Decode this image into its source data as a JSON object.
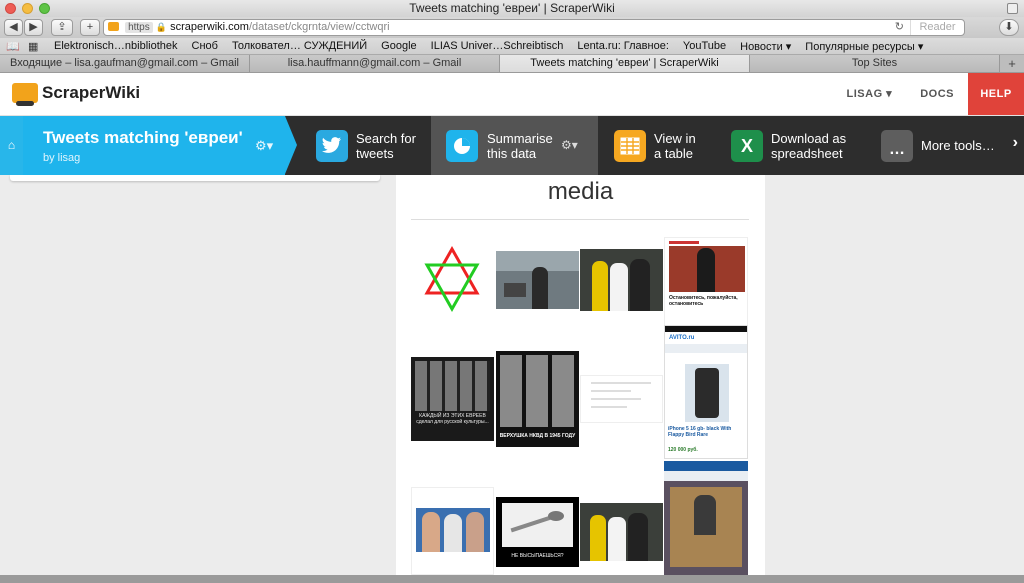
{
  "window": {
    "title": "Tweets matching 'евреи' | ScraperWiki"
  },
  "toolbar": {
    "back_label": "◀",
    "forward_label": "▶",
    "share_label": "⇪",
    "add_label": "+",
    "url_protocol": "https",
    "url_host": "scraperwiki.com",
    "url_path": "/dataset/ckgrnta/view/cctwqri",
    "reader_label": "Reader",
    "download_label": "⬇"
  },
  "bookmarks": {
    "items": [
      "Elektronisch…nbibliothek",
      "Сноб",
      "Толковател… СУЖДЕНИЙ",
      "Google",
      "ILIAS Univer…Schreibtisch",
      "Lenta.ru: Главное:",
      "YouTube",
      "Новости ▾",
      "Популярные ресурсы ▾"
    ]
  },
  "tabs": [
    {
      "label": "Входящие – lisa.gaufman@gmail.com – Gmail",
      "active": false
    },
    {
      "label": "lisa.hauffmann@gmail.com – Gmail",
      "active": false
    },
    {
      "label": "Tweets matching 'евреи' | ScraperWiki",
      "active": true
    },
    {
      "label": "Top Sites",
      "active": false
    }
  ],
  "header": {
    "logo_text": "ScraperWiki",
    "user_label": "LISAG ▾",
    "docs_label": "DOCS",
    "help_label": "HELP"
  },
  "dataset": {
    "title": "Tweets matching 'евреи'",
    "owner": "by lisag"
  },
  "tools": [
    {
      "line1": "Search for",
      "line2": "tweets",
      "icon": "twitter-icon",
      "color": "#2aa9e0"
    },
    {
      "line1": "Summarise",
      "line2": "this data",
      "icon": "pie-chart-icon",
      "color": "#1fb4ec"
    },
    {
      "line1": "View in",
      "line2": "a table",
      "icon": "table-icon",
      "color": "#f6a821"
    },
    {
      "line1": "Download as",
      "line2": "spreadsheet",
      "icon": "excel-icon",
      "color": "#1e8f4b"
    },
    {
      "line1": "More tools…",
      "line2": "",
      "icon": "more-icon",
      "color": "#5e5e5e"
    }
  ],
  "content": {
    "heading": "media",
    "thumb_text": {
      "news_caption": "Остановитесь, пожалуйста, остановитесь",
      "avito_brand": "AVITO.ru",
      "avito_title": "iPhone 5 16 gb- black With Flappy Bird Rare",
      "avito_price": "120 000 руб.",
      "nkvd_caption": "ВЕРХУШКА НКВД В 1945 ГОДУ",
      "spoon_caption": "НЕ ВЫСЫПАЕШЬСЯ?",
      "portraits_caption": "КАЖДЫЙ ИЗ ЭТИХ ЕВРЕЕВ сделал для русской культуры..."
    }
  },
  "colors": {
    "brand_blue": "#1fb4ec",
    "help_red": "#e0433a",
    "tool_strip": "#2d2d2d"
  }
}
